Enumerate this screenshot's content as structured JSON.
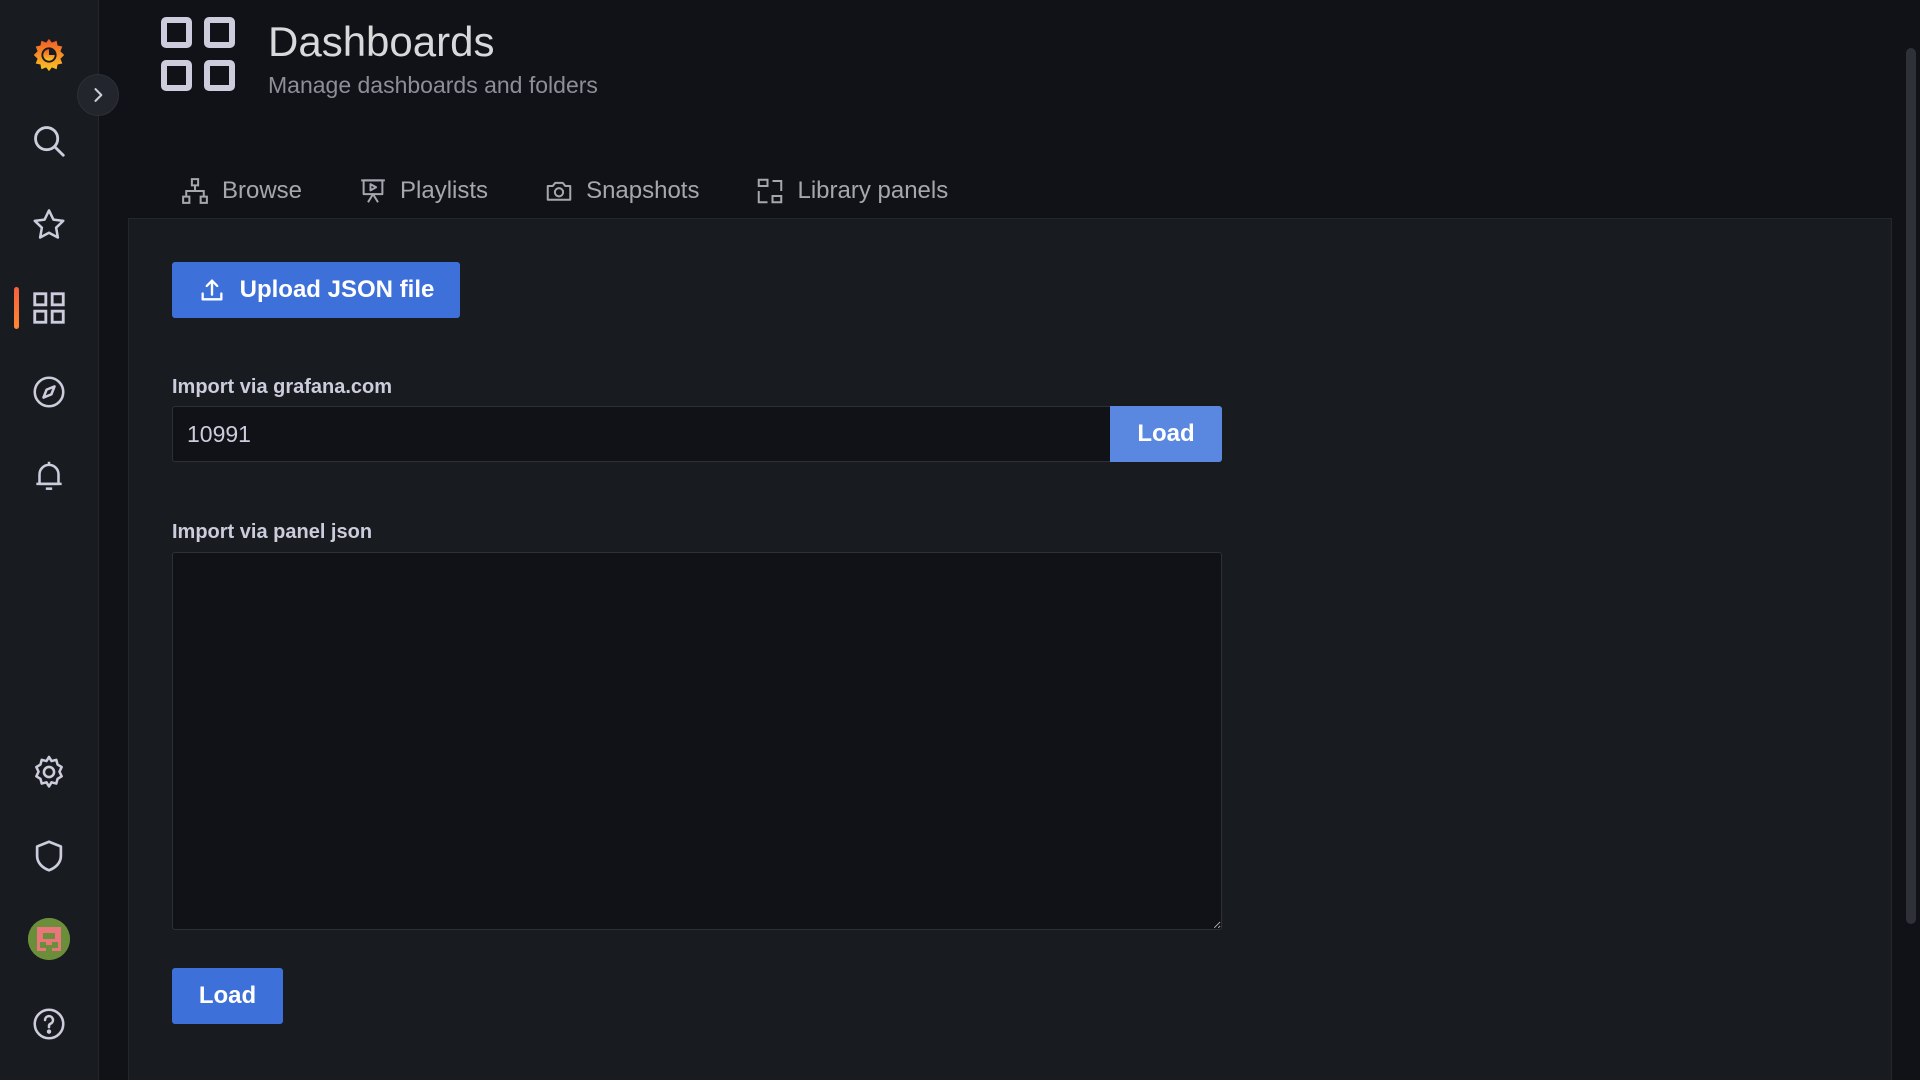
{
  "sidebar": {
    "icons": [
      "grafana-logo-icon",
      "search-icon",
      "star-icon",
      "dashboards-icon",
      "compass-icon",
      "bell-icon",
      "gear-icon",
      "shield-icon",
      "avatar",
      "help-icon"
    ],
    "active_item": "dashboards-icon",
    "accent": "#ff7a33"
  },
  "header": {
    "title": "Dashboards",
    "subtitle": "Manage dashboards and folders"
  },
  "tabs": [
    {
      "label": "Browse",
      "icon": "sitemap-icon"
    },
    {
      "label": "Playlists",
      "icon": "presentation-play-icon"
    },
    {
      "label": "Snapshots",
      "icon": "camera-icon"
    },
    {
      "label": "Library panels",
      "icon": "library-panel-icon"
    }
  ],
  "import": {
    "upload_label": "Upload JSON file",
    "gcom_label": "Import via grafana.com",
    "gcom_value": "10991",
    "gcom_load_label": "Load",
    "json_label": "Import via panel json",
    "json_value": "",
    "bottom_load_label": "Load"
  },
  "colors": {
    "primary_button": "#3d71d9",
    "background": "#111217",
    "panel": "#181b1f"
  }
}
